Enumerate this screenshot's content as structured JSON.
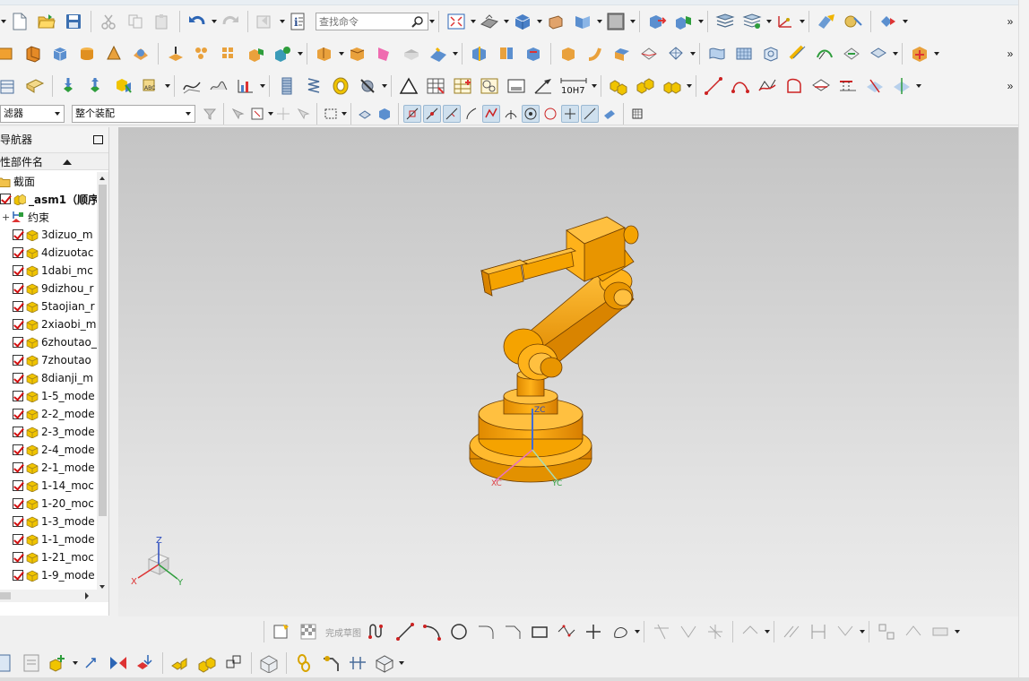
{
  "toolbar": {
    "search_placeholder": "查找命令",
    "tolerance_label": "10H7",
    "finish_sketch_label": "完成草图"
  },
  "selection_bar": {
    "type_filter": "滤器",
    "scope": "整个装配"
  },
  "navigator": {
    "title": "导航器",
    "column_header": "性部件名",
    "items": [
      {
        "label": "截面",
        "kind": "folder"
      },
      {
        "label": "_asm1（顺序",
        "kind": "assembly"
      },
      {
        "label": "约束",
        "kind": "constraints"
      },
      {
        "label": "3dizuo_m",
        "kind": "part"
      },
      {
        "label": "4dizuotac",
        "kind": "part"
      },
      {
        "label": "1dabi_mc",
        "kind": "part"
      },
      {
        "label": "9dizhou_r",
        "kind": "part"
      },
      {
        "label": "5taojian_r",
        "kind": "part"
      },
      {
        "label": "2xiaobi_m",
        "kind": "part"
      },
      {
        "label": "6zhoutao_",
        "kind": "part"
      },
      {
        "label": "7zhoutao",
        "kind": "part"
      },
      {
        "label": "8dianji_m",
        "kind": "part"
      },
      {
        "label": "1-5_mode",
        "kind": "part"
      },
      {
        "label": "2-2_mode",
        "kind": "part"
      },
      {
        "label": "2-3_mode",
        "kind": "part"
      },
      {
        "label": "2-4_mode",
        "kind": "part"
      },
      {
        "label": "2-1_mode",
        "kind": "part"
      },
      {
        "label": "1-14_moc",
        "kind": "part"
      },
      {
        "label": "1-20_moc",
        "kind": "part"
      },
      {
        "label": "1-3_mode",
        "kind": "part"
      },
      {
        "label": "1-1_mode",
        "kind": "part"
      },
      {
        "label": "1-21_moc",
        "kind": "part"
      },
      {
        "label": "1-9_mode",
        "kind": "part"
      }
    ]
  },
  "viewport": {
    "model_color": "#f5a300",
    "triad_labels": {
      "x": "X",
      "y": "Y",
      "z": "Z"
    },
    "model_axis_labels": {
      "x": "XC",
      "y": "YC",
      "z": "ZC"
    }
  }
}
